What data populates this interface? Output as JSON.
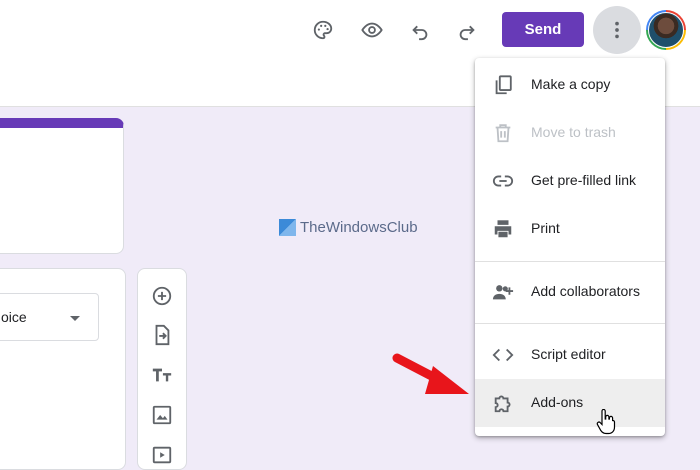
{
  "topbar": {
    "send_label": "Send",
    "icons": [
      "palette-icon",
      "eye-icon",
      "undo-icon",
      "redo-icon",
      "more-vert-icon"
    ]
  },
  "question": {
    "type_value": "oice"
  },
  "watermark": {
    "text": "TheWindowsClub"
  },
  "menu": {
    "items": [
      {
        "label": "Make a copy",
        "icon": "copy-icon",
        "disabled": false
      },
      {
        "label": "Move to trash",
        "icon": "trash-icon",
        "disabled": true
      },
      {
        "label": "Get pre-filled link",
        "icon": "link-icon",
        "disabled": false
      },
      {
        "label": "Print",
        "icon": "print-icon",
        "disabled": false
      },
      {
        "label": "Add collaborators",
        "icon": "add-people-icon",
        "disabled": false
      },
      {
        "label": "Script editor",
        "icon": "code-icon",
        "disabled": false
      },
      {
        "label": "Add-ons",
        "icon": "puzzle-icon",
        "disabled": false,
        "hovered": true
      }
    ]
  },
  "colors": {
    "brand": "#673ab7",
    "background": "#f0ebf8",
    "icon": "#5f6368",
    "annotation_arrow": "#e8151b"
  }
}
